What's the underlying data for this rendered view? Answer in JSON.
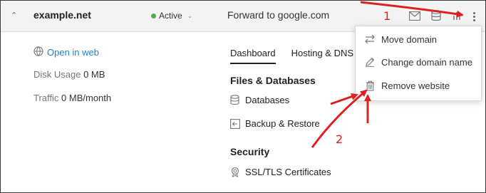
{
  "domain_row": {
    "domain": "example.net",
    "status": "Active",
    "hosting": "Forward to google.com",
    "colors": {
      "status_dot": "#53a851",
      "link": "#1d86c8",
      "annotation": "#e02020"
    }
  },
  "left_panel": {
    "open_in_web": "Open in web",
    "disk_usage_label": "Disk Usage",
    "disk_usage_value": "0 MB",
    "traffic_label": "Traffic",
    "traffic_value": "0 MB/month"
  },
  "tabs": [
    "Dashboard",
    "Hosting & DNS"
  ],
  "sections": {
    "files_title": "Files & Databases",
    "databases": "Databases",
    "backup": "Backup & Restore",
    "security_title": "Security",
    "ssl": "SSL/TLS Certificates"
  },
  "menu": {
    "items": [
      "Move domain",
      "Change domain name",
      "Remove website"
    ]
  },
  "annotations": {
    "n1": "1",
    "n2": "2"
  }
}
